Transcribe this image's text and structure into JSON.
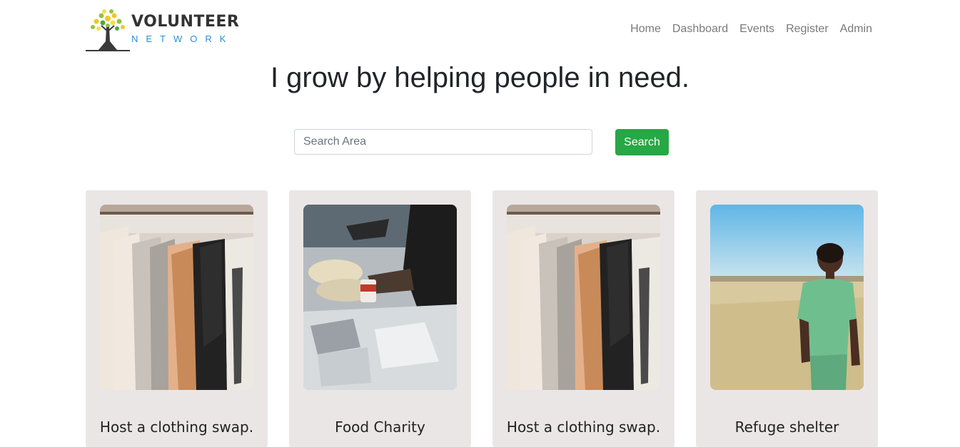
{
  "brand": {
    "name": "VOLUNTEER",
    "sub": "NETWORK"
  },
  "nav": {
    "items": [
      "Home",
      "Dashboard",
      "Events",
      "Register",
      "Admin"
    ]
  },
  "hero": {
    "headline": "I grow by helping people in need."
  },
  "search": {
    "placeholder": "Search Area",
    "value": "",
    "button_label": "Search"
  },
  "cards": [
    {
      "title": "Host a clothing swap.",
      "image": "clothes-rack-photo"
    },
    {
      "title": "Food Charity",
      "image": "food-donation-photo"
    },
    {
      "title": "Host a clothing swap.",
      "image": "clothes-rack-photo"
    },
    {
      "title": "Refuge shelter",
      "image": "child-in-field-photo"
    }
  ],
  "colors": {
    "accent_green": "#28a745",
    "brand_blue": "#2b8fd4",
    "card_bg": "#ebe6e6",
    "nav_text": "#7a7a7a"
  }
}
